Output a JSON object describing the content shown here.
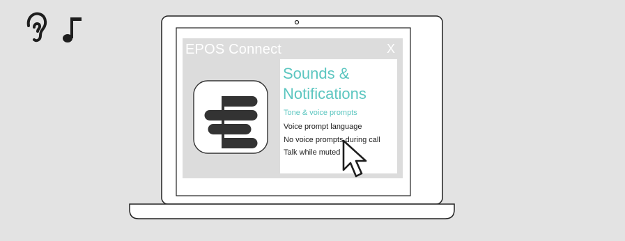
{
  "app": {
    "title": "EPOS Connect",
    "close_label": "X"
  },
  "panel": {
    "heading_line1": "Sounds &",
    "heading_line2": "Notifications",
    "section_heading": "Tone & voice prompts",
    "items": [
      {
        "label": "Voice prompt language"
      },
      {
        "label": "No voice prompts during call"
      },
      {
        "label": "Talk while muted"
      }
    ]
  },
  "icons": {
    "hearing": "ear-icon",
    "sound": "music-note-icon",
    "app_logo": "epos-logo-icon",
    "pointer": "mouse-pointer-icon"
  },
  "colors": {
    "background": "#e3e3e3",
    "accent": "#5cc6c0",
    "app_frame": "#dcdcdc",
    "panel": "#ffffff"
  }
}
